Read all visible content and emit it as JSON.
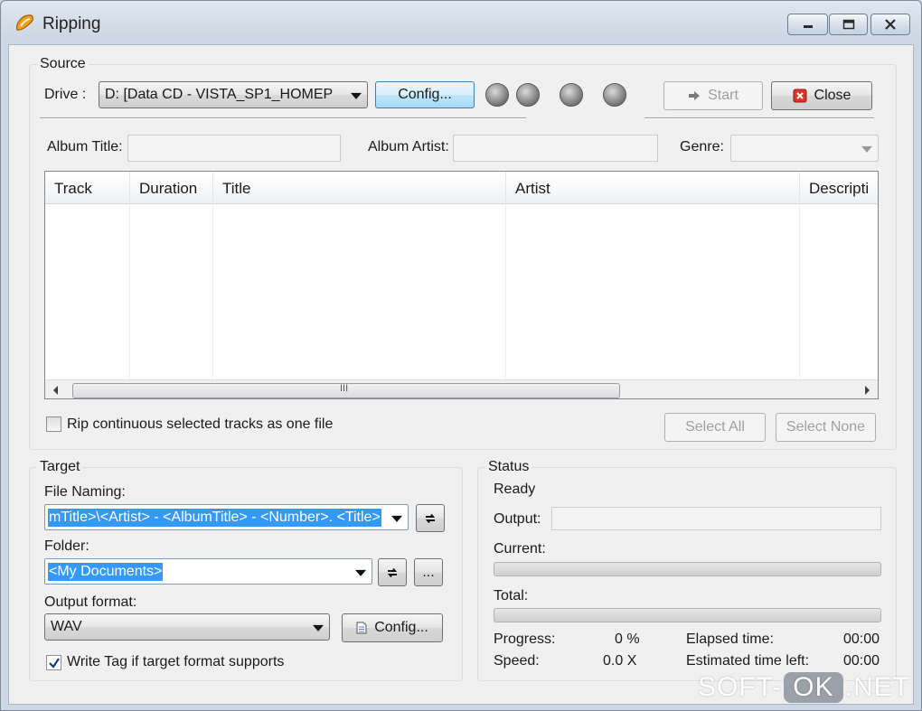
{
  "window": {
    "title": "Ripping"
  },
  "source": {
    "legend": "Source",
    "drive_label": "Drive :",
    "drive_value": "D:  [Data CD - VISTA_SP1_HOMEP",
    "config_label": "Config...",
    "start_label": "Start",
    "close_label": "Close",
    "album_title_label": "Album Title:",
    "album_artist_label": "Album Artist:",
    "genre_label": "Genre:",
    "columns": [
      "Track",
      "Duration",
      "Title",
      "Artist",
      "Descripti"
    ],
    "scroll_grip": "III",
    "rip_continuous_label": "Rip continuous selected tracks as one file",
    "select_all_label": "Select All",
    "select_none_label": "Select None"
  },
  "target": {
    "legend": "Target",
    "file_naming_label": "File Naming:",
    "file_naming_value": "mTitle>\\<Artist> - <AlbumTitle> - <Number>. <Title>",
    "folder_label": "Folder:",
    "folder_value": "<My Documents>",
    "browse_label": "...",
    "output_format_label": "Output format:",
    "output_format_value": "WAV",
    "config_label": "Config...",
    "write_tag_label": "Write Tag if target format supports",
    "write_tag_checked": true
  },
  "status": {
    "legend": "Status",
    "state": "Ready",
    "output_label": "Output:",
    "current_label": "Current:",
    "total_label": "Total:",
    "progress_label": "Progress:",
    "progress_value": "0 %",
    "speed_label": "Speed:",
    "speed_value": "0.0 X",
    "elapsed_label": "Elapsed time:",
    "elapsed_value": "00:00",
    "estimated_label": "Estimated time left:",
    "estimated_value": "00:00"
  },
  "watermark": {
    "part1": "SOFT-",
    "part2": "OK",
    "part3": ".NET"
  },
  "colors": {
    "selection": "#3399ff",
    "close_icon": "#d9362b",
    "app_icon": "#f0a020"
  }
}
